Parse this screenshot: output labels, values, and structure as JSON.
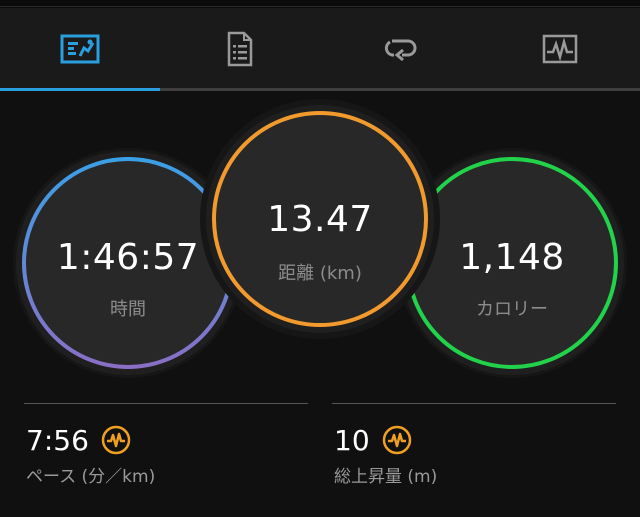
{
  "tabs": [
    {
      "name": "summary",
      "icon": "run-summary-icon",
      "active": true
    },
    {
      "name": "details",
      "icon": "document-icon",
      "active": false
    },
    {
      "name": "laps",
      "icon": "loop-icon",
      "active": false
    },
    {
      "name": "graphs",
      "icon": "chart-icon",
      "active": false
    }
  ],
  "rings": {
    "time": {
      "value": "1:46:57",
      "label": "時間"
    },
    "distance": {
      "value": "13.47",
      "label": "距離 (km)"
    },
    "calories": {
      "value": "1,148",
      "label": "カロリー"
    }
  },
  "stats": {
    "pace": {
      "value": "7:56",
      "label": "ペース (分／km)",
      "icon": "activity-wave-icon"
    },
    "elevation": {
      "value": "10",
      "label": "総上昇量 (m)",
      "icon": "activity-wave-icon"
    }
  },
  "colors": {
    "accent_blue": "#2a9fe0",
    "ring_time_start": "#3aa0e6",
    "ring_time_end": "#8a6fc6",
    "ring_distance": "#f29a2e",
    "ring_calories": "#22d24a",
    "badge_orange": "#f0a020"
  }
}
